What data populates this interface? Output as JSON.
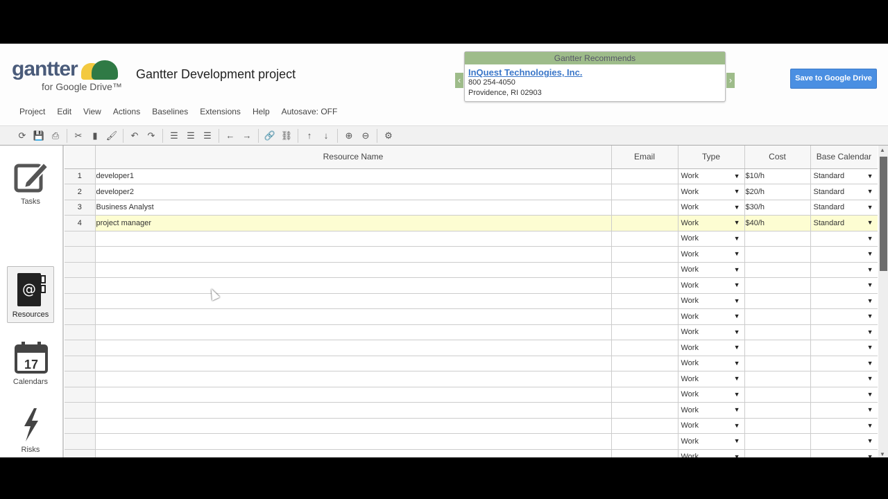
{
  "app": {
    "logo_word": "gantter",
    "logo_sub": "for Google Drive™",
    "title": "Gantter Development project"
  },
  "recommend": {
    "header": "Gantter Recommends",
    "company": "InQuest Technologies, Inc.",
    "phone": "800 254-4050",
    "address": "Providence, RI 02903",
    "prev": "‹",
    "next": "›"
  },
  "save_button": "Save to Google Drive",
  "menu": [
    "Project",
    "Edit",
    "View",
    "Actions",
    "Baselines",
    "Extensions",
    "Help",
    "Autosave: OFF"
  ],
  "toolbar": [
    [
      "refresh",
      "⟳"
    ],
    [
      "save",
      "💾"
    ],
    [
      "print",
      "⎙"
    ],
    "|",
    [
      "cut",
      "✂"
    ],
    [
      "paste",
      "▮"
    ],
    [
      "format-painter",
      "🖌"
    ],
    "|",
    [
      "undo",
      "↶"
    ],
    [
      "redo",
      "↷"
    ],
    "|",
    [
      "indent",
      "☰"
    ],
    [
      "outdent",
      "☰"
    ],
    [
      "insert",
      "☰"
    ],
    "|",
    [
      "move-left",
      "←"
    ],
    [
      "move-right",
      "→"
    ],
    "|",
    [
      "link",
      "🔗"
    ],
    [
      "unlink",
      "⛓"
    ],
    "|",
    [
      "move-up",
      "↑"
    ],
    [
      "move-down",
      "↓"
    ],
    "|",
    [
      "zoom-in",
      "⊕"
    ],
    [
      "zoom-out",
      "⊖"
    ],
    "|",
    [
      "settings",
      "⚙"
    ]
  ],
  "sidebar": [
    {
      "label": "Tasks",
      "icon": "pencil-square-icon"
    },
    {
      "label": "Resources",
      "icon": "address-book-icon",
      "selected": true
    },
    {
      "label": "Calendars",
      "icon": "calendar-icon",
      "day": "17"
    },
    {
      "label": "Risks",
      "icon": "lightning-icon"
    }
  ],
  "grid": {
    "columns": [
      "",
      "Resource Name",
      "Email",
      "Type",
      "Cost",
      "Base Calendar"
    ],
    "rows": [
      {
        "num": "1",
        "name": "developer1",
        "email": "",
        "type": "Work",
        "cost": "$10/h",
        "calendar": "Standard"
      },
      {
        "num": "2",
        "name": "developer2",
        "email": "",
        "type": "Work",
        "cost": "$20/h",
        "calendar": "Standard"
      },
      {
        "num": "3",
        "name": "Business Analyst",
        "email": "",
        "type": "Work",
        "cost": "$30/h",
        "calendar": "Standard"
      },
      {
        "num": "4",
        "name": "project manager",
        "email": "",
        "type": "Work",
        "cost": "$40/h",
        "calendar": "Standard",
        "highlight": true
      },
      {
        "type": "Work"
      },
      {
        "type": "Work"
      },
      {
        "type": "Work"
      },
      {
        "type": "Work"
      },
      {
        "type": "Work"
      },
      {
        "type": "Work"
      },
      {
        "type": "Work"
      },
      {
        "type": "Work"
      },
      {
        "type": "Work"
      },
      {
        "type": "Work"
      },
      {
        "type": "Work"
      },
      {
        "type": "Work"
      },
      {
        "type": "Work"
      },
      {
        "type": "Work"
      },
      {
        "type": "Work"
      }
    ]
  },
  "colors": {
    "accent": "#4a8fe2",
    "recommend": "#9ebc8a",
    "highlight_row": "#fdfdd2"
  }
}
